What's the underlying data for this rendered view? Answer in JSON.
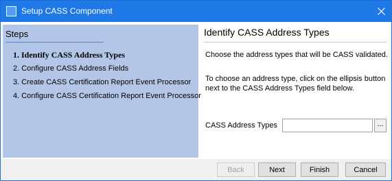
{
  "window": {
    "title": "Setup CASS Component"
  },
  "steps": {
    "title": "Steps",
    "items": [
      {
        "label": "1. Identify CASS Address Types",
        "active": true
      },
      {
        "label": "2. Configure CASS Address Fields",
        "active": false
      },
      {
        "label": "3. Create CASS Certification Report Event Processor",
        "active": false
      },
      {
        "label": "4. Configure CASS Certification Report Event Processor",
        "active": false
      }
    ]
  },
  "content": {
    "title": "Identify CASS Address Types",
    "description": "Choose the address types that will be CASS validated.",
    "instruction": "To choose an address type, click on the ellipsis button next to the CASS Address Types field below.",
    "field_label": "CASS Address Types",
    "field_value": "",
    "ellipsis_label": "..."
  },
  "buttons": {
    "back": "Back",
    "next": "Next",
    "finish": "Finish",
    "cancel": "Cancel"
  },
  "colors": {
    "titlebar": "#1e78e6",
    "steps_panel": "#b4c6e7"
  }
}
